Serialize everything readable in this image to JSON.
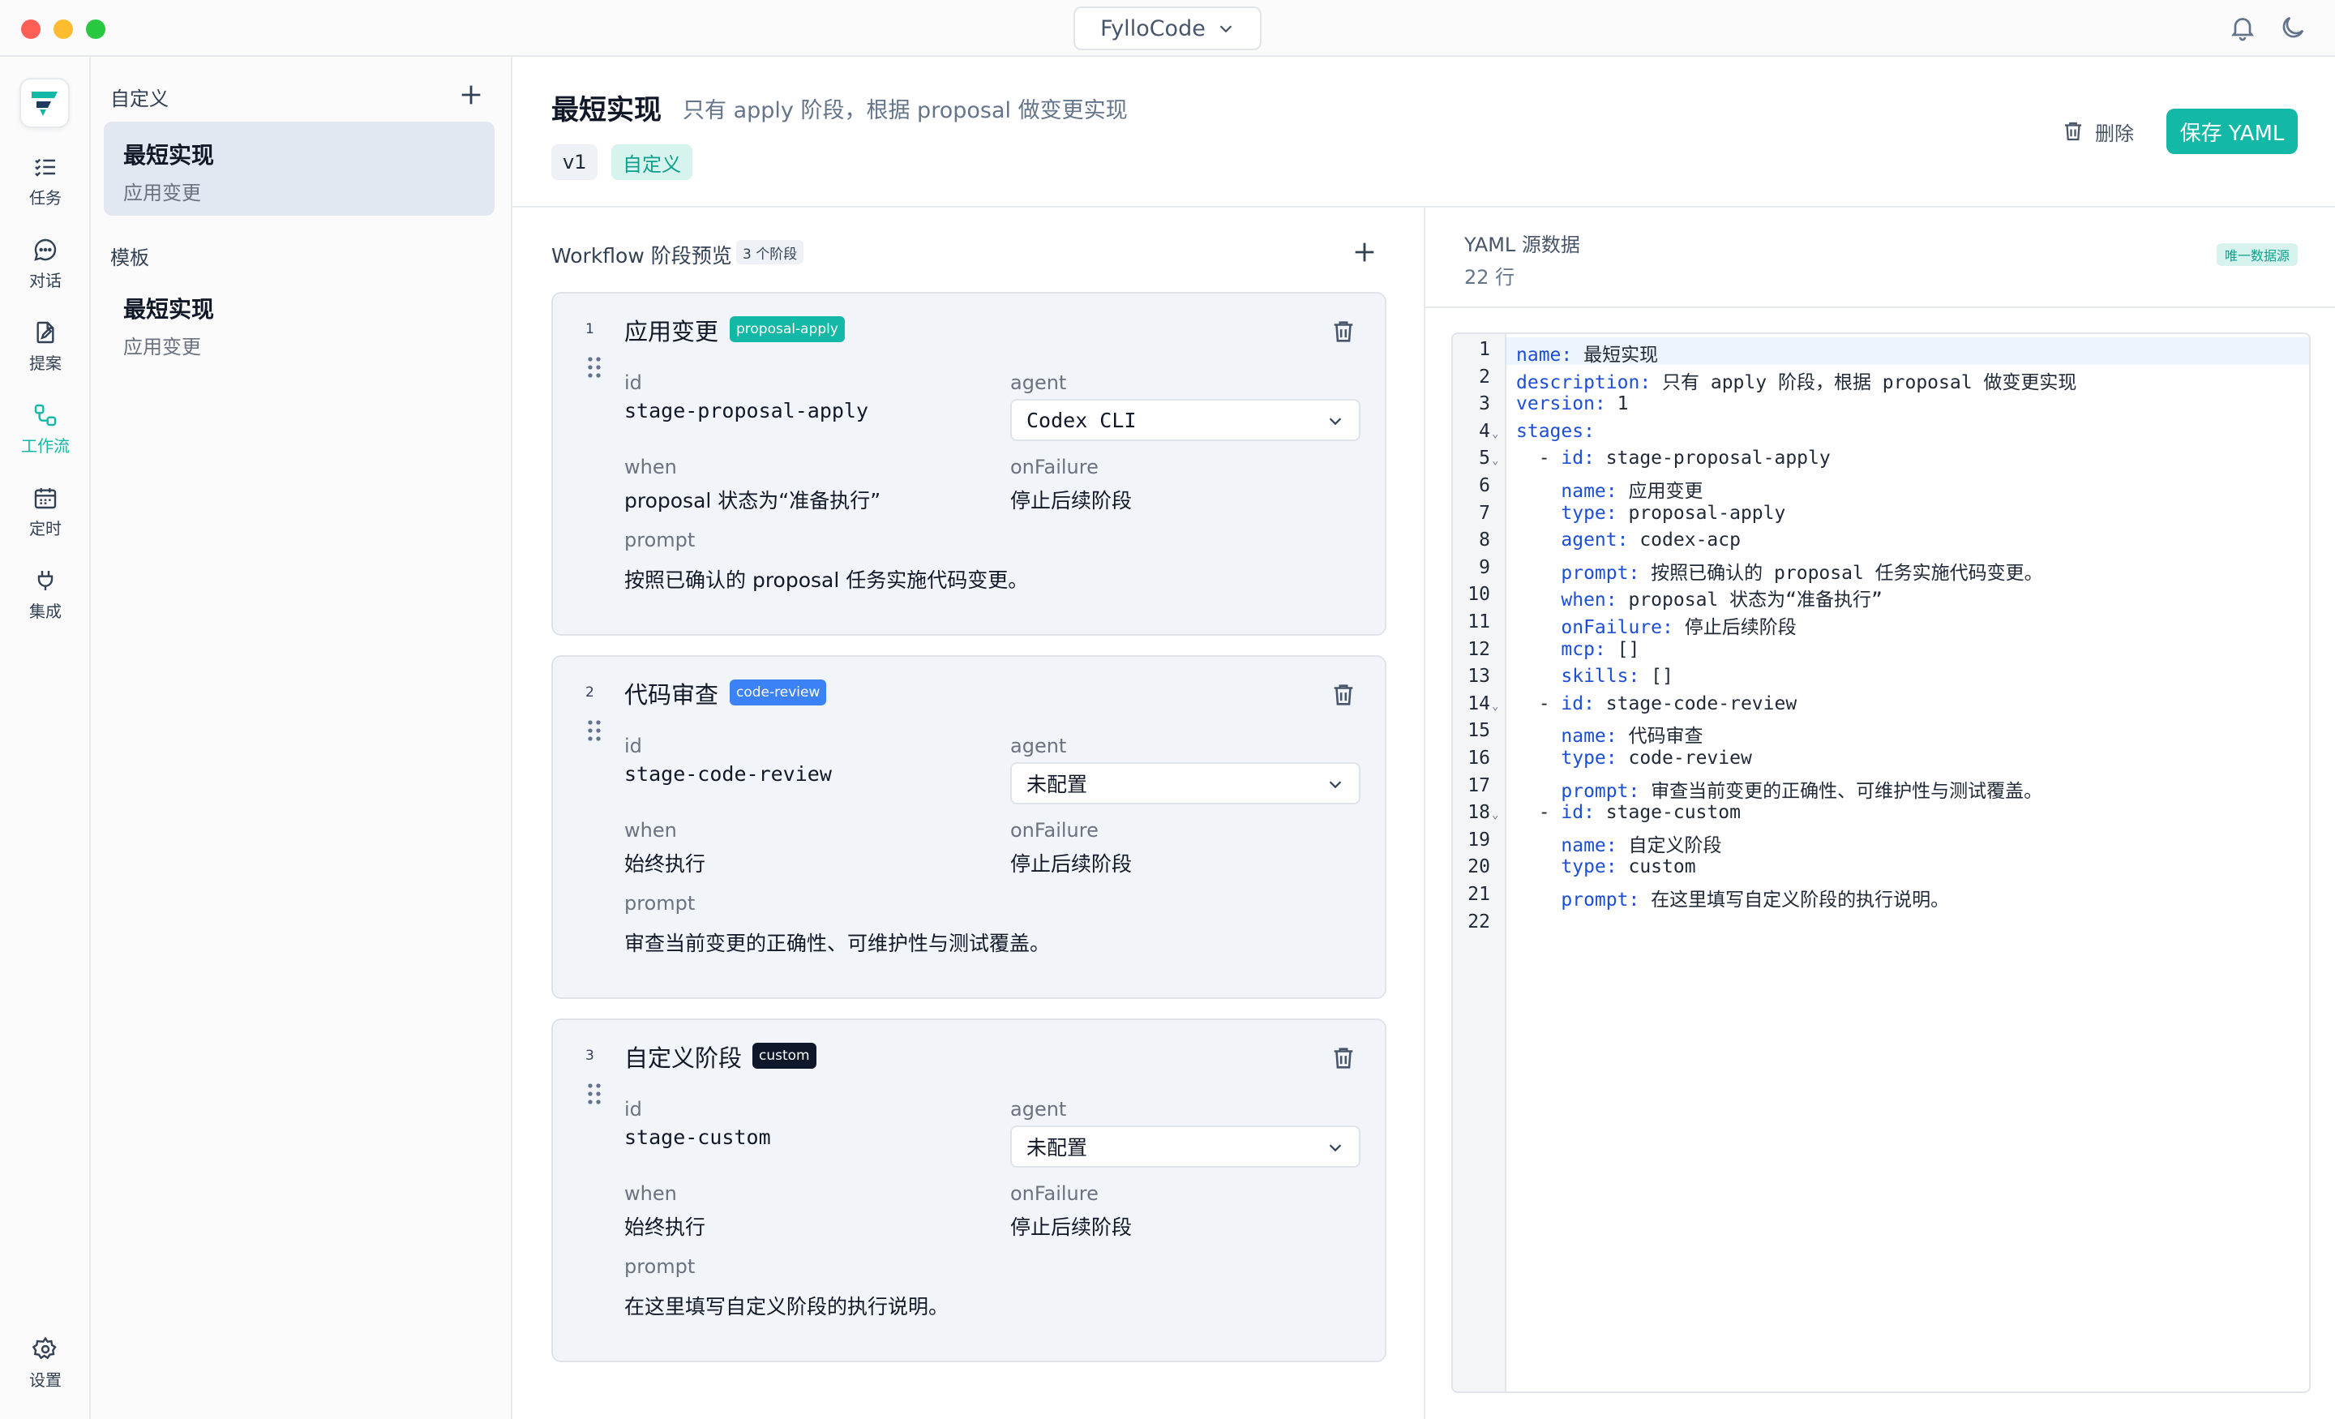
{
  "titlebar": {
    "app_name": "FylloCode"
  },
  "rail": {
    "items": [
      {
        "label": "任务",
        "icon": "list-check-icon"
      },
      {
        "label": "对话",
        "icon": "chat-bubble-icon"
      },
      {
        "label": "提案",
        "icon": "file-edit-icon"
      },
      {
        "label": "工作流",
        "icon": "workflow-icon",
        "active": true
      },
      {
        "label": "定时",
        "icon": "calendar-icon"
      },
      {
        "label": "集成",
        "icon": "plug-icon"
      }
    ],
    "settings_label": "设置"
  },
  "sidebar": {
    "custom_header": "自定义",
    "custom_items": [
      {
        "title": "最短实现",
        "subtitle": "应用变更"
      }
    ],
    "template_header": "模板",
    "template_items": [
      {
        "title": "最短实现",
        "subtitle": "应用变更"
      }
    ]
  },
  "header": {
    "title": "最短实现",
    "subtitle": "只有 apply 阶段，根据 proposal 做变更实现",
    "version_tag": "v1",
    "custom_tag": "自定义",
    "delete_label": "删除",
    "save_label": "保存 YAML"
  },
  "workflow": {
    "title": "Workflow 阶段预览",
    "count": "3 个阶段",
    "field_labels": {
      "id": "id",
      "agent": "agent",
      "when": "when",
      "onFailure": "onFailure",
      "prompt": "prompt"
    },
    "stages": [
      {
        "num": "1",
        "name": "应用变更",
        "type": "proposal-apply",
        "badge_color": "#14b8a6",
        "id": "stage-proposal-apply",
        "agent": "Codex CLI",
        "when": "proposal 状态为“准备执行”",
        "onFailure": "停止后续阶段",
        "prompt": "按照已确认的 proposal 任务实施代码变更。"
      },
      {
        "num": "2",
        "name": "代码审查",
        "type": "code-review",
        "badge_color": "#3b82f6",
        "id": "stage-code-review",
        "agent": "未配置",
        "when": "始终执行",
        "onFailure": "停止后续阶段",
        "prompt": "审查当前变更的正确性、可维护性与测试覆盖。"
      },
      {
        "num": "3",
        "name": "自定义阶段",
        "type": "custom",
        "badge_color": "#0f172a",
        "id": "stage-custom",
        "agent": "未配置",
        "when": "始终执行",
        "onFailure": "停止后续阶段",
        "prompt": "在这里填写自定义阶段的执行说明。"
      }
    ]
  },
  "yaml": {
    "title": "YAML 源数据",
    "line_count": "22 行",
    "badge": "唯一数据源",
    "lines": [
      {
        "indent": "",
        "key": "name",
        "value": " 最短实现"
      },
      {
        "indent": "",
        "key": "description",
        "value": " 只有 apply 阶段，根据 proposal 做变更实现"
      },
      {
        "indent": "",
        "key": "version",
        "value": " 1"
      },
      {
        "indent": "",
        "key": "stages",
        "value": "",
        "fold": true
      },
      {
        "indent": "  - ",
        "key": "id",
        "value": " stage-proposal-apply",
        "fold": true
      },
      {
        "indent": "    ",
        "key": "name",
        "value": " 应用变更"
      },
      {
        "indent": "    ",
        "key": "type",
        "value": " proposal-apply"
      },
      {
        "indent": "    ",
        "key": "agent",
        "value": " codex-acp"
      },
      {
        "indent": "    ",
        "key": "prompt",
        "value": " 按照已确认的 proposal 任务实施代码变更。"
      },
      {
        "indent": "    ",
        "key": "when",
        "value": " proposal 状态为“准备执行”"
      },
      {
        "indent": "    ",
        "key": "onFailure",
        "value": " 停止后续阶段"
      },
      {
        "indent": "    ",
        "key": "mcp",
        "value": " []"
      },
      {
        "indent": "    ",
        "key": "skills",
        "value": " []"
      },
      {
        "indent": "  - ",
        "key": "id",
        "value": " stage-code-review",
        "fold": true
      },
      {
        "indent": "    ",
        "key": "name",
        "value": " 代码审查"
      },
      {
        "indent": "    ",
        "key": "type",
        "value": " code-review"
      },
      {
        "indent": "    ",
        "key": "prompt",
        "value": " 审查当前变更的正确性、可维护性与测试覆盖。"
      },
      {
        "indent": "  - ",
        "key": "id",
        "value": " stage-custom",
        "fold": true
      },
      {
        "indent": "    ",
        "key": "name",
        "value": " 自定义阶段"
      },
      {
        "indent": "    ",
        "key": "type",
        "value": " custom"
      },
      {
        "indent": "    ",
        "key": "prompt",
        "value": " 在这里填写自定义阶段的执行说明。"
      },
      {
        "indent": "",
        "key": "",
        "value": ""
      }
    ]
  },
  "colors": {
    "accent": "#14b8a6",
    "keyword": "#1d4ed8"
  }
}
